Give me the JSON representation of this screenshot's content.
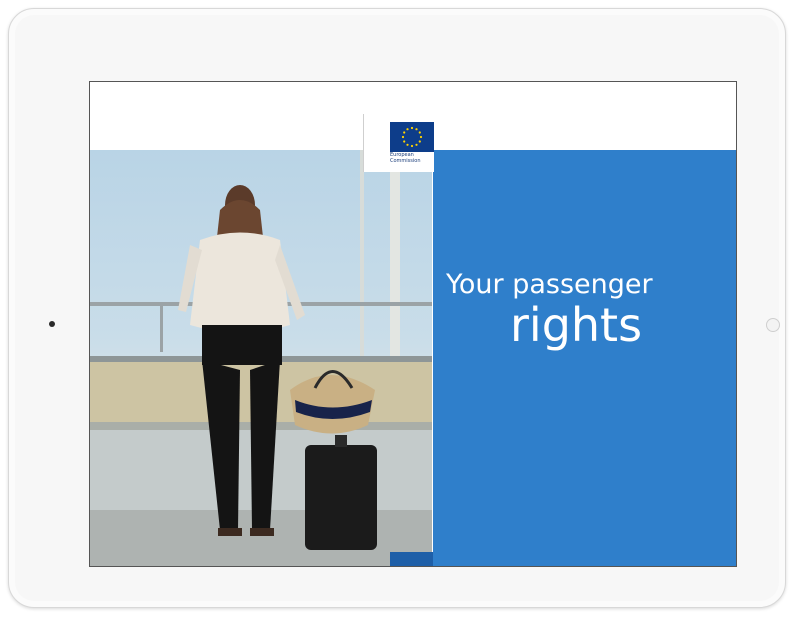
{
  "cover": {
    "title_line1": "Your passenger",
    "title_line2": "rights",
    "logo_line1": "European",
    "logo_line2": "Commission"
  },
  "colors": {
    "panel_blue": "#2f7fcb",
    "flag_blue": "#0d3d8a",
    "star_yellow": "#ffd400"
  }
}
